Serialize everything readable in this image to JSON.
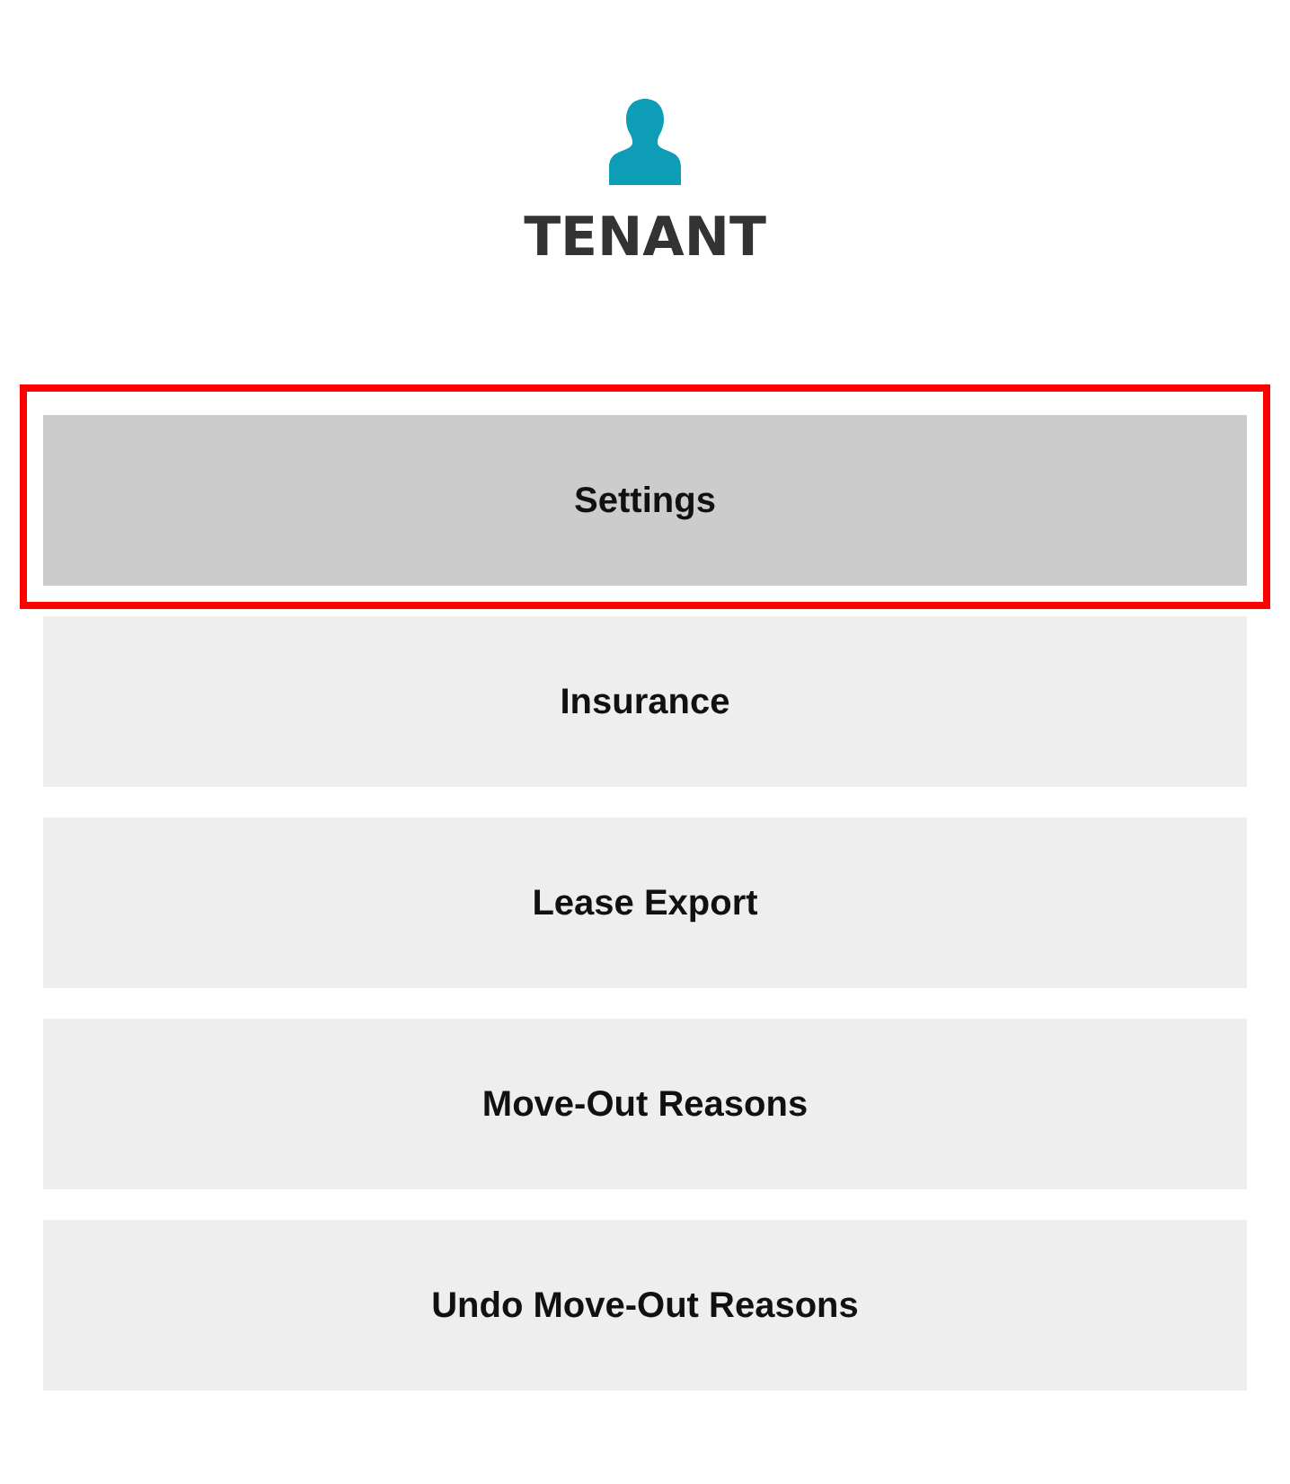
{
  "header": {
    "title": "TENANT"
  },
  "items": [
    {
      "label": "Settings",
      "selected": true
    },
    {
      "label": "Insurance",
      "selected": false
    },
    {
      "label": "Lease Export",
      "selected": false
    },
    {
      "label": "Move-Out Reasons",
      "selected": false
    },
    {
      "label": "Undo Move-Out Reasons",
      "selected": false
    }
  ]
}
